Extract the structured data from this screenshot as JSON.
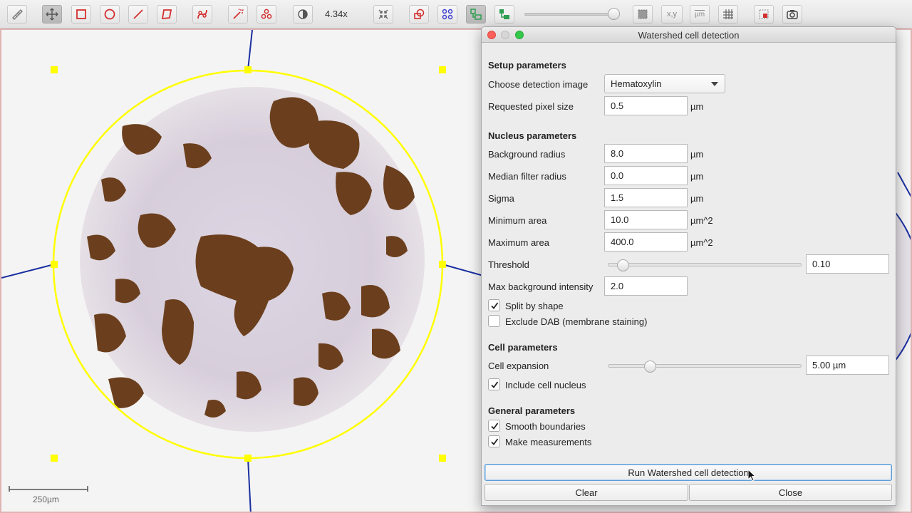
{
  "toolbar": {
    "zoom": "4.34x",
    "coord_label": "x,y",
    "unit_label": "µm",
    "icons": [
      "ruler-icon",
      "move-icon",
      "rectangle-icon",
      "ellipse-icon",
      "line-icon",
      "polygon-icon",
      "polyline-icon",
      "wand-icon",
      "points-icon",
      "brightness-icon",
      "fit-icon",
      "annotation-toggle-icon",
      "tma-grid-icon",
      "detection-fill-icon",
      "cell-icon",
      "zoom-slider",
      "selection-icon",
      "coordinates-icon",
      "scalebar-icon",
      "grid-icon",
      "overlay-icon",
      "camera-icon"
    ],
    "accent": "#d32f2f"
  },
  "viewer": {
    "scalebar_label": "250µm",
    "annotation_color": "#ffff00",
    "grid_color": "#1a2fa0"
  },
  "dialog": {
    "title": "Watershed cell detection",
    "setup_title": "Setup parameters",
    "detection_image_label": "Choose detection image",
    "detection_image_value": "Hematoxylin",
    "pixel_size_label": "Requested pixel size",
    "pixel_size_value": "0.5",
    "nucleus_title": "Nucleus parameters",
    "background_radius_label": "Background radius",
    "background_radius_value": "8.0",
    "median_filter_label": "Median filter radius",
    "median_filter_value": "0.0",
    "sigma_label": "Sigma",
    "sigma_value": "1.5",
    "min_area_label": "Minimum area",
    "min_area_value": "10.0",
    "max_area_label": "Maximum area",
    "max_area_value": "400.0",
    "threshold_label": "Threshold",
    "threshold_value": "0.10",
    "threshold_level": 0.05,
    "max_bg_label": "Max background intensity",
    "max_bg_value": "2.0",
    "split_by_shape_label": "Split by shape",
    "split_by_shape_checked": true,
    "exclude_dab_label": "Exclude DAB (membrane staining)",
    "exclude_dab_checked": false,
    "cell_title": "Cell parameters",
    "cell_expansion_label": "Cell expansion",
    "cell_expansion_value": "5.00 µm",
    "cell_expansion_level": 0.2,
    "include_nucleus_label": "Include cell nucleus",
    "include_nucleus_checked": true,
    "general_title": "General parameters",
    "smooth_label": "Smooth boundaries",
    "smooth_checked": true,
    "measurements_label": "Make measurements",
    "measurements_checked": true,
    "run_label": "Run Watershed cell detection",
    "clear_label": "Clear",
    "close_label": "Close",
    "unit_um": "µm",
    "unit_um2": "µm^2"
  }
}
